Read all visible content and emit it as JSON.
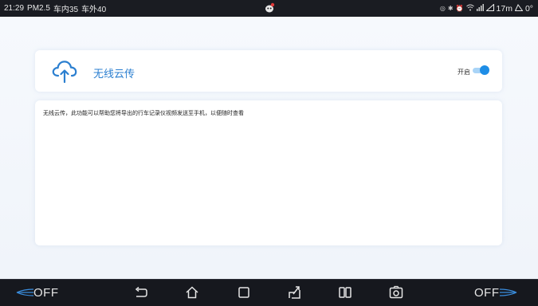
{
  "status_bar": {
    "time": "21:29",
    "pm25": "PM2.5",
    "inside_temp": "车内35",
    "outside_temp": "车外40",
    "distance": "17m",
    "angle": "0°",
    "icons": [
      "notification-icon",
      "location-icon",
      "bluetooth-icon",
      "alarm-icon",
      "wifi-icon",
      "signal-icon",
      "incline-icon"
    ]
  },
  "header": {
    "icon": "cloud-upload-icon",
    "title": "无线云传",
    "toggle_label": "开启",
    "toggle_on": true
  },
  "description": {
    "text": "无线云传，此功能可以帮助您将导出的行车记录仪视频发送至手机，以便随时查看"
  },
  "nav_bar": {
    "left_label": "OFF",
    "right_label": "OFF",
    "buttons": [
      "back-icon",
      "home-icon",
      "recent-apps-icon",
      "navigation-icon",
      "split-screen-icon",
      "camera-icon"
    ]
  },
  "colors": {
    "accent": "#1e8de6",
    "title": "#2b7fd0",
    "bar": "#16181e"
  }
}
